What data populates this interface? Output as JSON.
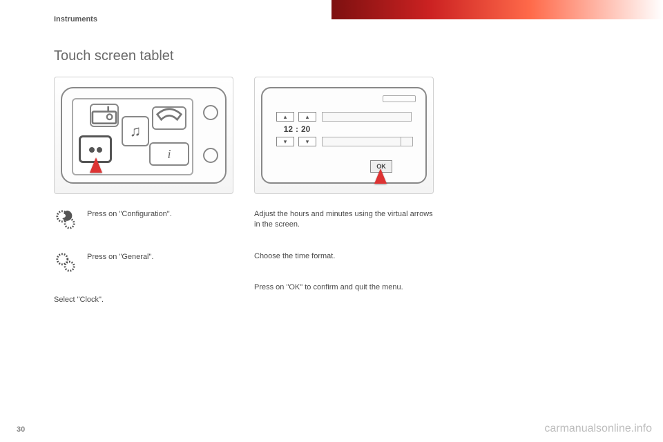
{
  "header": {
    "section": "Instruments"
  },
  "title": "Touch screen tablet",
  "clock": {
    "hours": "12",
    "minutes": "20",
    "ok_label": "OK"
  },
  "steps_left": [
    "Press on \"Configuration\".",
    "Press on \"General\".",
    "Select \"Clock\"."
  ],
  "steps_right": [
    "Adjust the hours and minutes using the virtual arrows in the screen.",
    "Choose the time format.",
    "Press on \"OK\" to confirm and quit the menu."
  ],
  "page_number": "30",
  "watermark": "carmanualsonline.info"
}
